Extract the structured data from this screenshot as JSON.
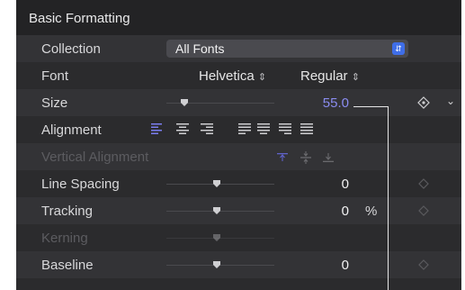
{
  "header": {
    "title": "Basic Formatting"
  },
  "rows": {
    "collection": {
      "label": "Collection",
      "value": "All Fonts"
    },
    "font": {
      "label": "Font",
      "family": "Helvetica",
      "style": "Regular"
    },
    "size": {
      "label": "Size",
      "value": "55.0",
      "slider_level": 0.2
    },
    "alignment": {
      "label": "Alignment"
    },
    "vertical_alignment": {
      "label": "Vertical Alignment"
    },
    "line_spacing": {
      "label": "Line Spacing",
      "value": "0",
      "slider_level": 0.5
    },
    "tracking": {
      "label": "Tracking",
      "value": "0",
      "unit": "%",
      "slider_level": 0.5
    },
    "kerning": {
      "label": "Kerning",
      "slider_level": 0.5
    },
    "baseline": {
      "label": "Baseline",
      "value": "0",
      "slider_level": 0.5
    }
  },
  "colors": {
    "panel": "#2b2b2d",
    "header": "#232325",
    "accent_blue": "#8a8cf0",
    "select_button": "#3f6ee8"
  },
  "icons": {
    "select_button": "up-down-chevron-icon",
    "keyframe": "diamond-icon",
    "menu": "chevron-down-icon"
  }
}
